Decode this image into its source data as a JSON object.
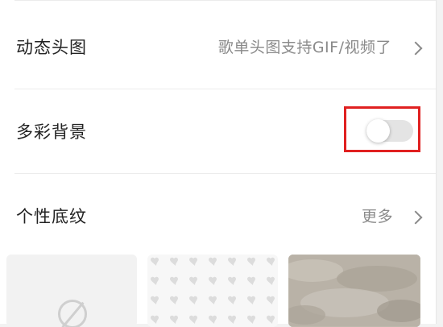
{
  "settings": {
    "dynamic_header": {
      "label": "动态头图",
      "value": "歌单头图支持GIF/视频了"
    },
    "colorful_background": {
      "label": "多彩背景",
      "toggle_on": false
    },
    "texture": {
      "label": "个性底纹",
      "more": "更多"
    }
  },
  "texture_options": [
    {
      "name": "none",
      "icon": "ban-icon"
    },
    {
      "name": "hearts",
      "icon": "heart-pattern"
    },
    {
      "name": "linen",
      "icon": "texture-pattern"
    }
  ],
  "colors": {
    "highlight": "#e02020",
    "toggle_off": "#e4e4e4",
    "secondary_text": "#8a8a8a"
  }
}
